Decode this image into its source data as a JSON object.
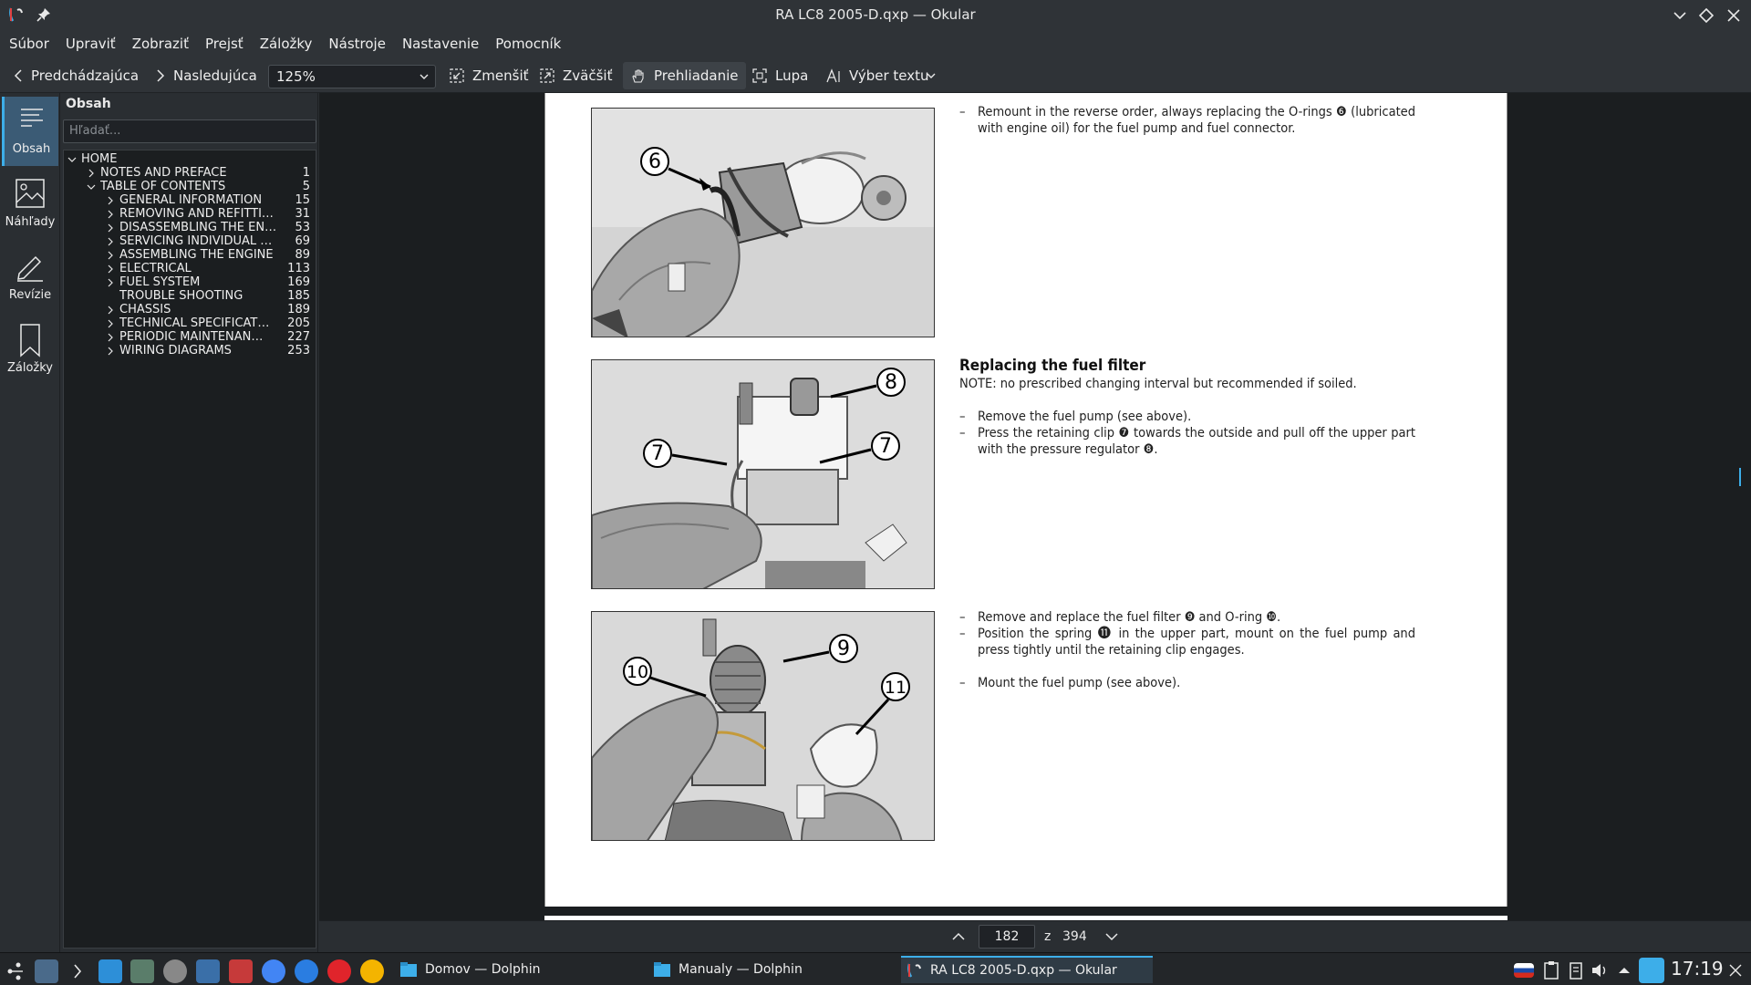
{
  "window": {
    "title": "RA LC8 2005-D.qxp — Okular"
  },
  "menu": [
    "Súbor",
    "Upraviť",
    "Zobraziť",
    "Prejsť",
    "Záložky",
    "Nástroje",
    "Nastavenie",
    "Pomocník"
  ],
  "toolbar": {
    "prev": "Predchádzajúca",
    "next": "Nasledujúca",
    "zoom": "125%",
    "zoom_out": "Zmenšiť",
    "zoom_in": "Zväčšiť",
    "browse": "Prehliadanie",
    "magnifier": "Lupa",
    "text_select": "Výber textu"
  },
  "rail": [
    "Obsah",
    "Náhľady",
    "Revízie",
    "Záložky"
  ],
  "sidebar": {
    "title": "Obsah",
    "search_placeholder": "Hľadať...",
    "toc": [
      {
        "label": "HOME",
        "page": "",
        "level": 0,
        "expanded": true
      },
      {
        "label": "NOTES AND PREFACE",
        "page": "1",
        "level": 1,
        "expanded": false
      },
      {
        "label": "TABLE OF CONTENTS",
        "page": "5",
        "level": 1,
        "expanded": true
      },
      {
        "label": "GENERAL INFORMATION",
        "page": "15",
        "level": 2,
        "expanded": false
      },
      {
        "label": "REMOVING AND REFITTI…",
        "page": "31",
        "level": 2,
        "expanded": false
      },
      {
        "label": "DISASSEMBLING THE EN…",
        "page": "53",
        "level": 2,
        "expanded": false
      },
      {
        "label": "SERVICING INDIVIDUAL …",
        "page": "69",
        "level": 2,
        "expanded": false
      },
      {
        "label": "ASSEMBLING THE ENGINE",
        "page": "89",
        "level": 2,
        "expanded": false
      },
      {
        "label": "ELECTRICAL",
        "page": "113",
        "level": 2,
        "expanded": false
      },
      {
        "label": "FUEL SYSTEM",
        "page": "169",
        "level": 2,
        "expanded": false
      },
      {
        "label": "TROUBLE SHOOTING",
        "page": "185",
        "level": 2,
        "leaf": true
      },
      {
        "label": "CHASSIS",
        "page": "189",
        "level": 2,
        "expanded": false
      },
      {
        "label": "TECHNICAL SPECIFICAT…",
        "page": "205",
        "level": 2,
        "expanded": false
      },
      {
        "label": "PERIODIC MAINTENAN…",
        "page": "227",
        "level": 2,
        "expanded": false
      },
      {
        "label": "WIRING DIAGRAMS",
        "page": "253",
        "level": 2,
        "expanded": false
      }
    ]
  },
  "document": {
    "block1": {
      "bullets": [
        "Remount in the reverse order, always replacing the O-rings ❻ (lubricated with engine oil) for the fuel pump and fuel connector."
      ]
    },
    "block2": {
      "heading": "Replacing the fuel filter",
      "note": "NOTE: no prescribed changing interval but recommended if soiled.",
      "bullets": [
        "Remove the fuel pump (see above).",
        "Press the retaining clip ❼ towards the outside and pull off the upper part with the pressure regulator ❽."
      ]
    },
    "block3": {
      "bullets": [
        "Remove and replace the fuel filter ❾ and O-ring ❿.",
        "Position the spring ⓫ in the upper part, mount on the fuel pump and press tightly until the retaining clip engages."
      ],
      "bullet_after_gap": "Mount the fuel pump (see above)."
    },
    "callouts": {
      "photo1": [
        "6"
      ],
      "photo2": [
        "8",
        "7",
        "7"
      ],
      "photo3": [
        "9",
        "10",
        "11"
      ]
    }
  },
  "pagenav": {
    "current": "182",
    "of": "z",
    "total": "394"
  },
  "taskbar": {
    "tasks": [
      "Domov — Dolphin",
      "Manualy — Dolphin",
      "RA LC8 2005-D.qxp — Okular"
    ],
    "clock": "17:19"
  }
}
